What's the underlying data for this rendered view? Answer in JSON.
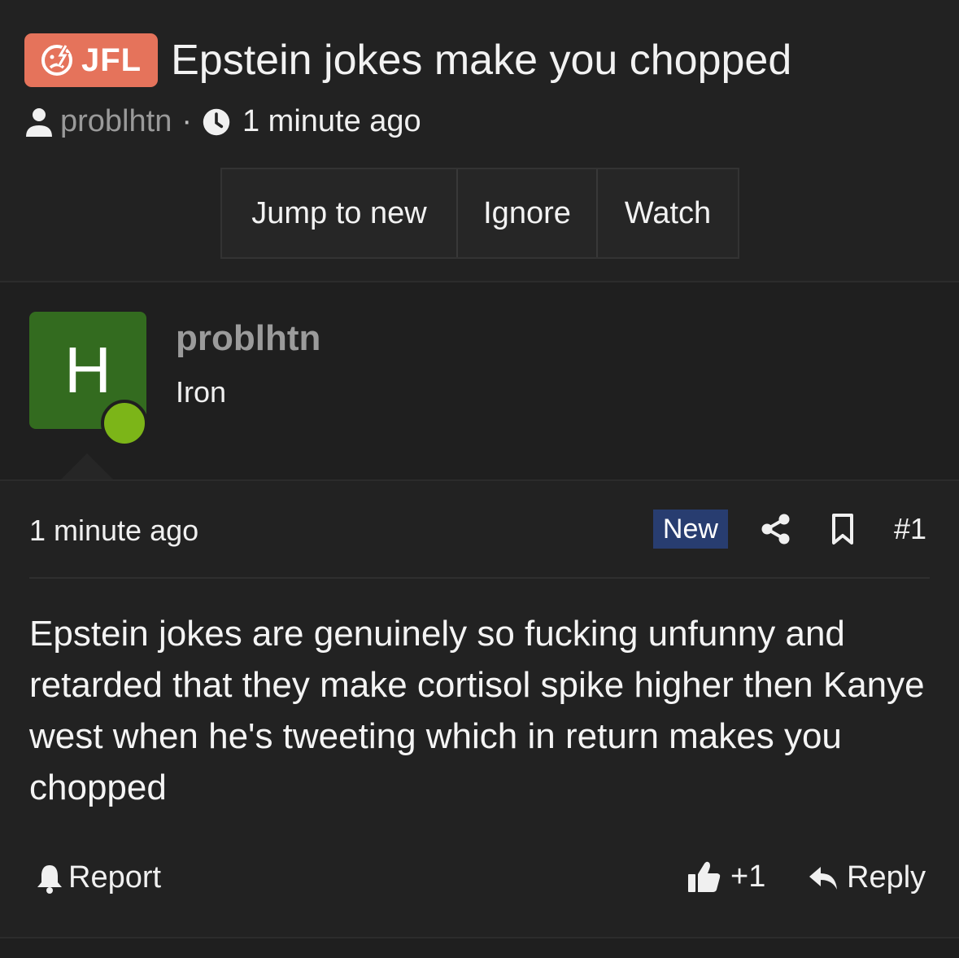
{
  "thread": {
    "prefix": "JFL",
    "title": "Epstein jokes make you chopped",
    "author": "problhtn",
    "separator": "·",
    "time": "1 minute ago",
    "buttons": {
      "jump": "Jump to new",
      "ignore": "Ignore",
      "watch": "Watch"
    }
  },
  "user": {
    "avatar_letter": "H",
    "name": "problhtn",
    "title": "Iron",
    "online": true
  },
  "post": {
    "time": "1 minute ago",
    "badge": "New",
    "number": "#1",
    "body": "Epstein jokes are genuinely so fucking unfunny and retarded that they make cortisol spike higher then Kanye west when he's tweeting which in return makes you chopped",
    "actions": {
      "report": "Report",
      "reaction": "+1",
      "reply": "Reply"
    }
  },
  "icons": {
    "prefix": "sad-face-lightning-icon",
    "author": "user-icon",
    "time": "clock-icon",
    "share": "share-icon",
    "bookmark": "bookmark-icon",
    "report": "bell-icon",
    "reaction": "thumbs-up-icon",
    "reply": "reply-arrow-icon"
  },
  "colors": {
    "background": "#1f1f1f",
    "prefix_bg": "#e5735b",
    "avatar_bg": "#336b1f",
    "online": "#7cb518",
    "badge_new": "#283d70"
  }
}
